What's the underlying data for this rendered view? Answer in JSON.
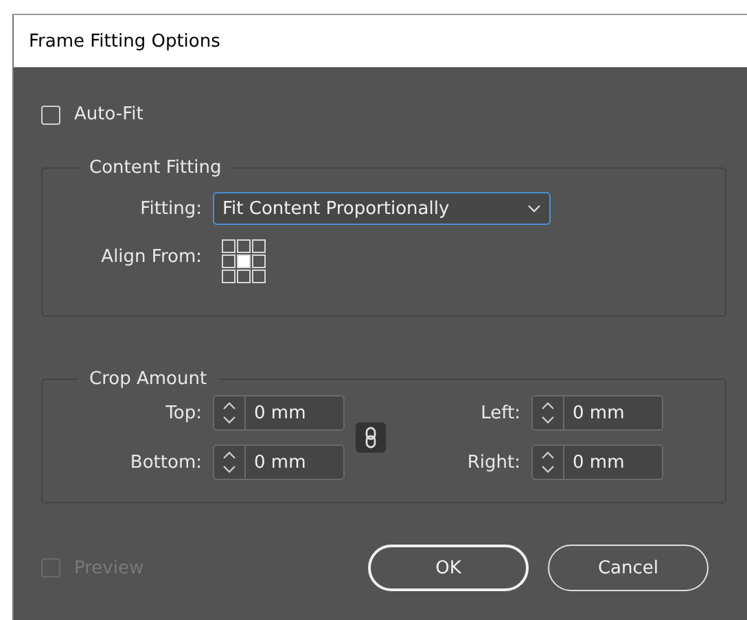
{
  "window": {
    "title": "Frame Fitting Options"
  },
  "auto_fit": {
    "label": "Auto-Fit",
    "checked": false
  },
  "content_fitting": {
    "title": "Content Fitting",
    "fitting": {
      "label": "Fitting:",
      "value": "Fit Content Proportionally"
    },
    "align_from": {
      "label": "Align From:"
    }
  },
  "crop_amount": {
    "title": "Crop Amount",
    "fields": [
      {
        "label": "Top:",
        "value": "0 mm"
      },
      {
        "label": "Left:",
        "value": "0 mm"
      },
      {
        "label": "Bottom:",
        "value": "0 mm"
      },
      {
        "label": "Right:",
        "value": "0 mm"
      }
    ]
  },
  "preview": {
    "label": "Preview",
    "checked": false,
    "disabled": true
  },
  "buttons": [
    {
      "label": "OK",
      "default": true
    },
    {
      "label": "Cancel",
      "default": false
    }
  ]
}
